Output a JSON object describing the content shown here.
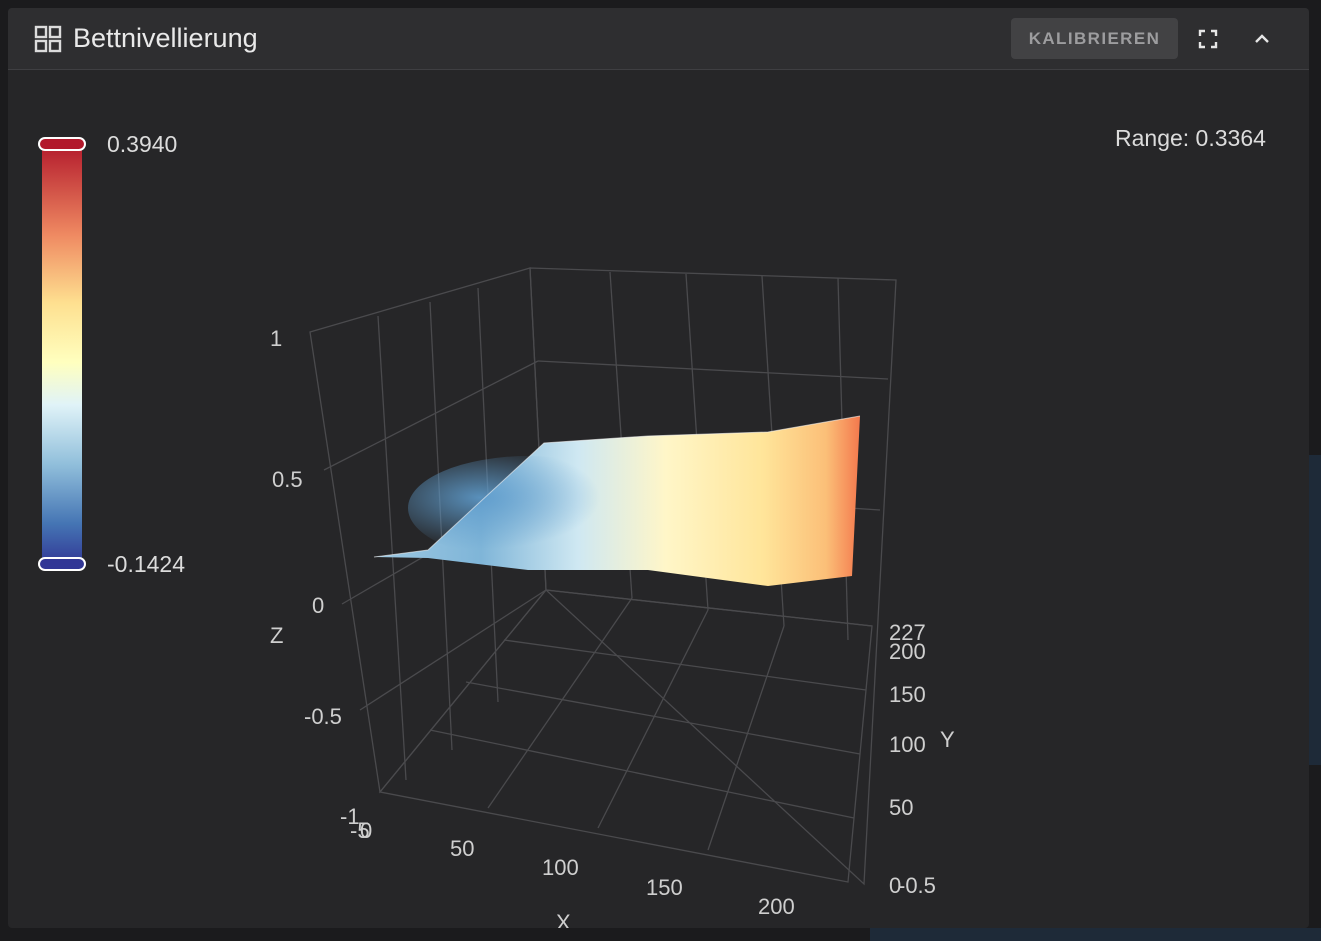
{
  "panel": {
    "title": "Bettnivellierung",
    "calibrate_label": "KALIBRIEREN",
    "icons": {
      "title": "grid-view-icon",
      "fullscreen": "fullscreen-icon",
      "collapse": "chevron-up-icon"
    }
  },
  "colorbar": {
    "max_label": "0.3940",
    "min_label": "-0.1424",
    "colors": [
      "#b2182b",
      "#ef8a62",
      "#fee090",
      "#ffffbf",
      "#e0f3f8",
      "#91bfdb",
      "#4575b4",
      "#313695"
    ]
  },
  "range_text": "Range: 0.3364",
  "chart_data": {
    "type": "surface",
    "z_axis": {
      "label": "Z",
      "ticks": [
        "1",
        "0.5",
        "0",
        "-0.5",
        "-1"
      ]
    },
    "x_axis": {
      "label": "X",
      "ticks": [
        "-5",
        "0",
        "50",
        "100",
        "150",
        "200"
      ]
    },
    "y_axis": {
      "label": "Y",
      "ticks": [
        "227",
        "200",
        "150",
        "100",
        "50",
        "0",
        "-0.5"
      ]
    },
    "z_range": [
      -0.1424,
      0.394
    ],
    "range": 0.3364
  }
}
